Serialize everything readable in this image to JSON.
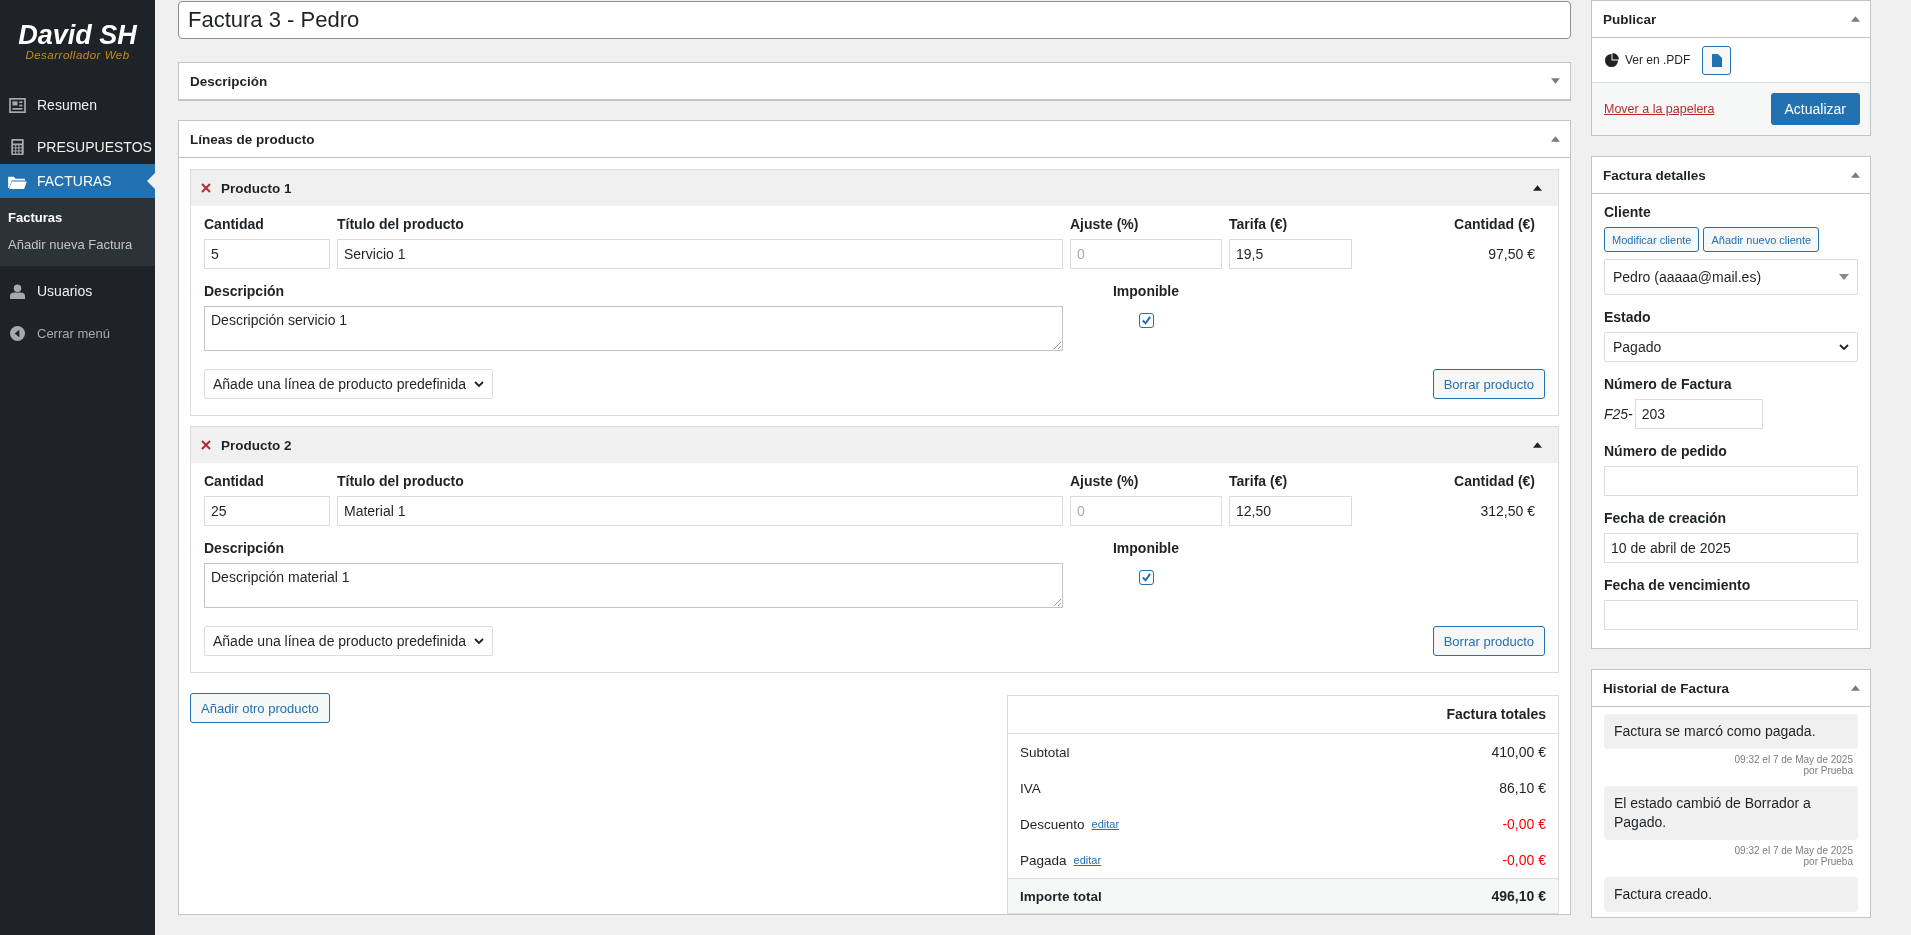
{
  "sidebar": {
    "logo": {
      "title": "David SH",
      "subtitle": "Desarrollador Web"
    },
    "items": [
      {
        "label": "Resumen",
        "kind": "dashboard",
        "selected": false
      },
      {
        "label": "PRESUPUESTOS",
        "kind": "calculator",
        "selected": false
      },
      {
        "label": "FACTURAS",
        "kind": "folder",
        "selected": true,
        "children": [
          {
            "label": "Facturas",
            "selected": true
          },
          {
            "label": "Añadir nueva Factura",
            "selected": false
          }
        ]
      },
      {
        "label": "Usuarios",
        "kind": "user",
        "selected": false
      }
    ],
    "collapse": "Cerrar menú"
  },
  "title_field": {
    "value": "Factura 3 - Pedro"
  },
  "description_box": {
    "title": "Descripción",
    "expanded": false
  },
  "product_lines": {
    "title": "Líneas de producto",
    "expanded": true,
    "products": [
      {
        "title": "Producto 1",
        "expanded": true,
        "quantity_label": "Cantidad",
        "quantity": "5",
        "title_label": "Título del producto",
        "product_title": "Servicio 1",
        "adjustment_label": "Ajuste (%)",
        "adjustment_placeholder": "0",
        "rate_label": "Tarifa (€)",
        "rate": "19,5",
        "amount_label": "Cantidad (€)",
        "amount": "97,50 €",
        "description_label": "Descripción",
        "description": "Descripción servicio 1",
        "taxable_label": "Imponible",
        "taxable": true,
        "preset_select": "Añade una línea de producto predefinida",
        "delete_button": "Borrar producto"
      },
      {
        "title": "Producto 2",
        "expanded": true,
        "quantity_label": "Cantidad",
        "quantity": "25",
        "title_label": "Título del producto",
        "product_title": "Material 1",
        "adjustment_label": "Ajuste (%)",
        "adjustment_placeholder": "0",
        "rate_label": "Tarifa (€)",
        "rate": "12,50",
        "amount_label": "Cantidad (€)",
        "amount": "312,50 €",
        "description_label": "Descripción",
        "description": "Descripción material 1",
        "taxable_label": "Imponible",
        "taxable": true,
        "preset_select": "Añade una línea de producto predefinida",
        "delete_button": "Borrar producto"
      }
    ],
    "add_button": "Añadir otro producto"
  },
  "totals": {
    "title": "Factura totales",
    "rows": [
      {
        "label": "Subtotal",
        "kind": "plain",
        "value": "410,00 €"
      },
      {
        "label": "IVA",
        "kind": "plain",
        "value": "86,10 €"
      },
      {
        "label": "Descuento",
        "kind": "negative",
        "link": "editar",
        "value": "-0,00 €"
      },
      {
        "label": "Pagada",
        "kind": "negative",
        "link": "editar",
        "value": "-0,00 €"
      }
    ],
    "total": {
      "label": "Importe total",
      "value": "496,10 €"
    }
  },
  "publish": {
    "title": "Publicar",
    "expanded": true,
    "pdf_label": "Ver en .PDF",
    "trash_link": "Mover a la papelera",
    "update_button": "Actualizar"
  },
  "details": {
    "title": "Factura detalles",
    "expanded": true,
    "client_label": "Cliente",
    "modify_button": "Modificar cliente",
    "new_client_button": "Añadir nuevo cliente",
    "client_select": "Pedro (aaaaa@mail.es)",
    "status_label": "Estado",
    "status_select": "Pagado",
    "number_label": "Número de Factura",
    "number_prefix": "F25-",
    "number": "203",
    "order_label": "Número de pedido",
    "created_label": "Fecha de creación",
    "created": "10 de abril de 2025",
    "due_label": "Fecha de vencimiento"
  },
  "history": {
    "title": "Historial de Factura",
    "expanded": true,
    "notes": [
      {
        "text": "Factura se marcó como pagada.",
        "meta": [
          "09:32 el 7 de May de 2025",
          "por Prueba"
        ]
      },
      {
        "text": "El estado cambió de Borrador a Pagado.",
        "meta": [
          "09:32 el 7 de May de 2025",
          "por Prueba"
        ]
      },
      {
        "text": "Factura creado."
      }
    ]
  }
}
